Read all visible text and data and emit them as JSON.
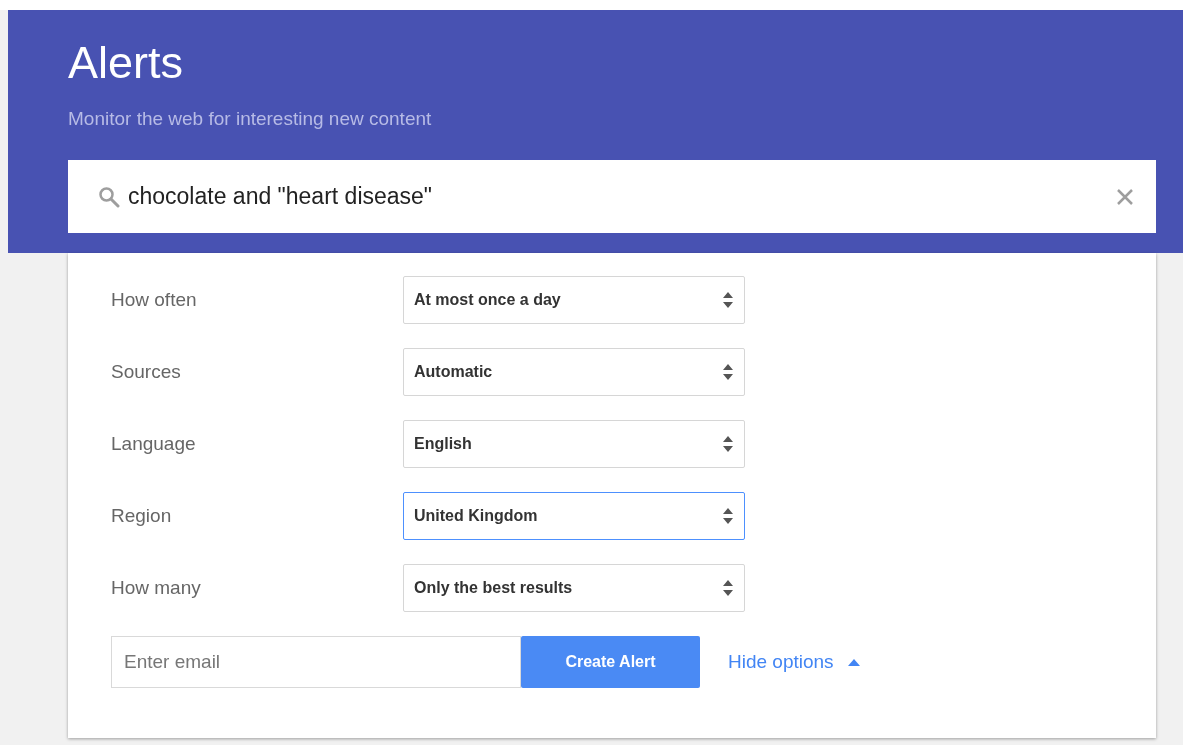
{
  "header": {
    "title": "Alerts",
    "subtitle": "Monitor the web for interesting new content"
  },
  "search": {
    "value": "chocolate and \"heart disease\""
  },
  "options": [
    {
      "label": "How often",
      "value": "At most once a day",
      "focused": false
    },
    {
      "label": "Sources",
      "value": "Automatic",
      "focused": false
    },
    {
      "label": "Language",
      "value": "English",
      "focused": false
    },
    {
      "label": "Region",
      "value": "United Kingdom",
      "focused": true
    },
    {
      "label": "How many",
      "value": "Only the best results",
      "focused": false
    }
  ],
  "email": {
    "placeholder": "Enter email"
  },
  "create_button": "Create Alert",
  "hide_options": "Hide options"
}
